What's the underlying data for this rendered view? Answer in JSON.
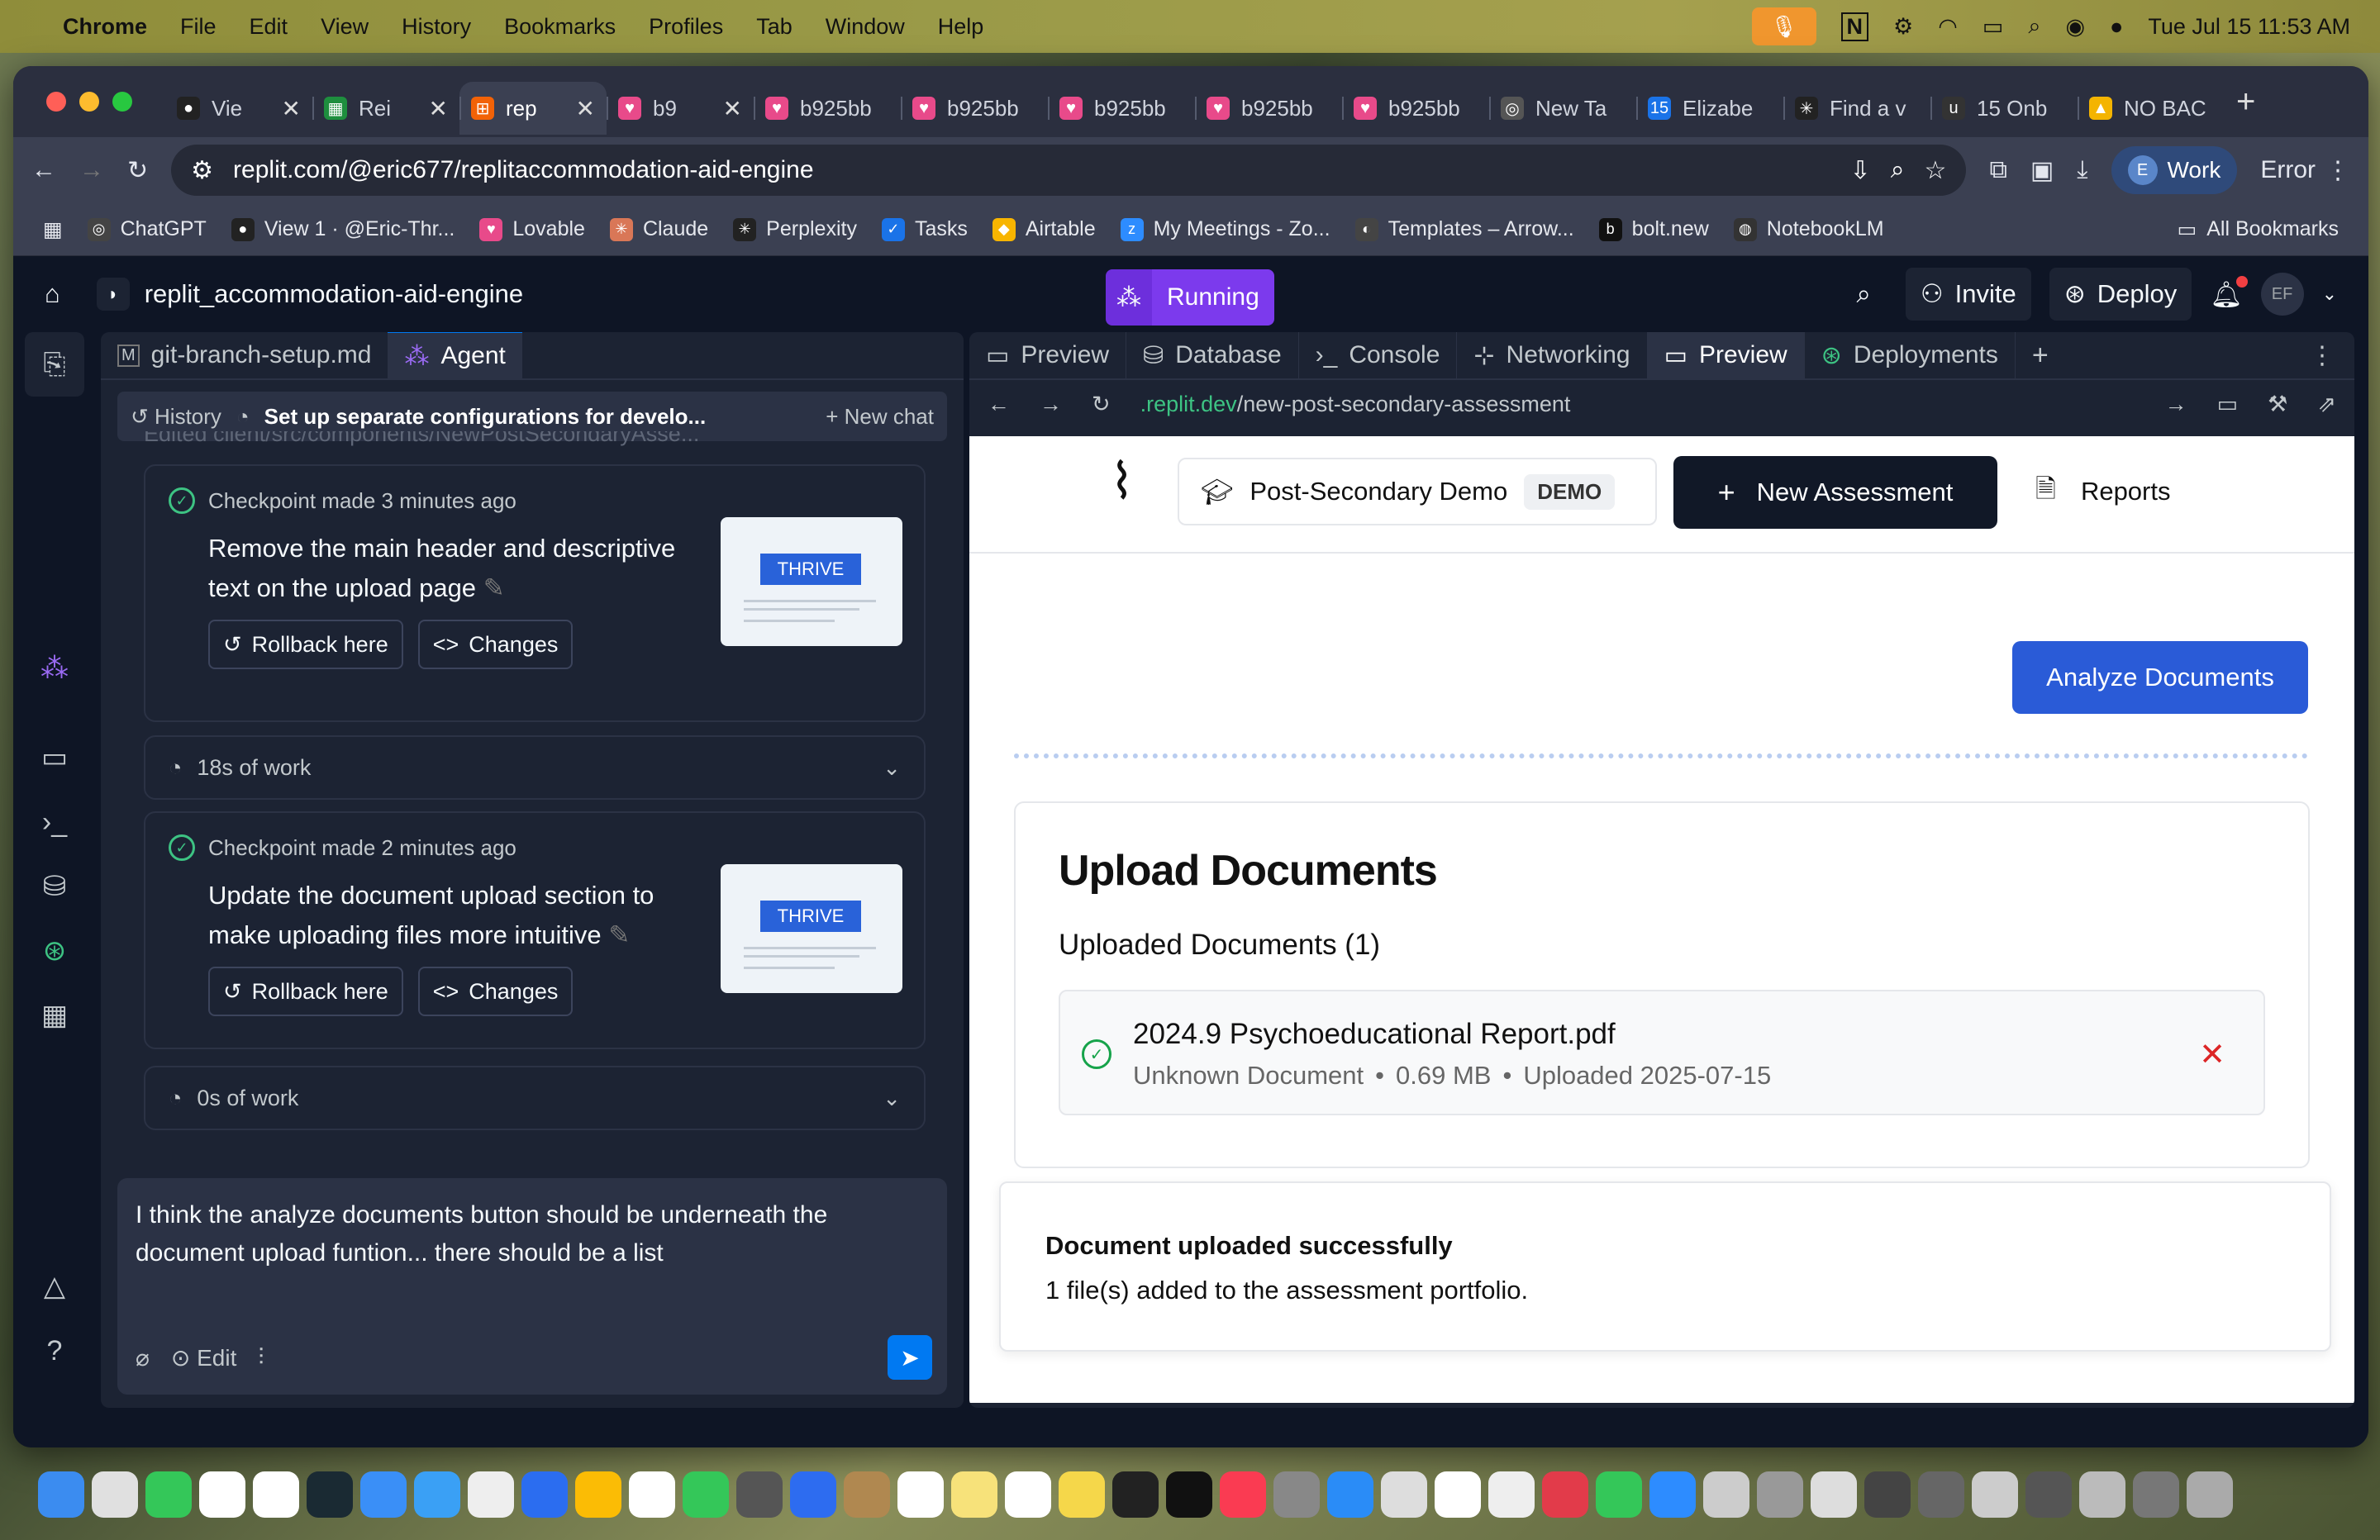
{
  "menubar": {
    "app": "Chrome",
    "items": [
      "File",
      "Edit",
      "View",
      "History",
      "Bookmarks",
      "Profiles",
      "Tab",
      "Window",
      "Help"
    ],
    "datetime": "Tue Jul 15  11:53 AM"
  },
  "tabs": [
    {
      "label": "Vie",
      "icon": "github-icon",
      "color": "#222"
    },
    {
      "label": "Rei",
      "icon": "sheets-icon",
      "color": "#1e8e3e"
    },
    {
      "label": "rep",
      "icon": "replit-icon",
      "color": "#f26207",
      "active": true
    },
    {
      "label": "b9",
      "icon": "lovable-icon",
      "color": "#e84a8a"
    },
    {
      "label": "b925bb",
      "icon": "lovable-icon",
      "color": "#e84a8a"
    },
    {
      "label": "b925bb",
      "icon": "lovable-icon",
      "color": "#e84a8a"
    },
    {
      "label": "b925bb",
      "icon": "lovable-icon",
      "color": "#e84a8a"
    },
    {
      "label": "b925bb",
      "icon": "lovable-icon",
      "color": "#e84a8a"
    },
    {
      "label": "b925bb",
      "icon": "lovable-icon",
      "color": "#e84a8a"
    },
    {
      "label": "New Ta",
      "icon": "chrome-icon",
      "color": "#555"
    },
    {
      "label": "Elizabe",
      "icon": "calendar-icon",
      "color": "#1a73e8"
    },
    {
      "label": "Find a v",
      "icon": "perplexity-icon",
      "color": "#222"
    },
    {
      "label": "15 Onb",
      "icon": "u-icon",
      "color": "#333"
    },
    {
      "label": "NO BAC",
      "icon": "drive-icon",
      "color": "#f4b400"
    }
  ],
  "address": {
    "url": "replit.com/@eric677/replitaccommodation-aid-engine",
    "profile_initial": "E",
    "profile": "Work",
    "error": "Error"
  },
  "bookmarks": [
    "ChatGPT",
    "View 1 · @Eric-Thr...",
    "Lovable",
    "Claude",
    "Perplexity",
    "Tasks",
    "Airtable",
    "My Meetings - Zo...",
    "Templates – Arrow...",
    "bolt.new",
    "NotebookLM"
  ],
  "all_bookmarks": "All Bookmarks",
  "replit": {
    "project": "replit_accommodation-aid-engine",
    "status": "Running",
    "invite": "Invite",
    "deploy": "Deploy",
    "avatar": "EF",
    "left_tabs": {
      "file": "git-branch-setup.md",
      "agent": "Agent"
    },
    "history": "History",
    "chat_title": "Set up separate configurations for develo...",
    "new_chat": "New chat",
    "partial_line": "Edited client/src/components/NewPostSecondaryAsse...",
    "checkpoints": [
      {
        "time": "Checkpoint made 3 minutes ago",
        "message": "Remove the main header and descriptive text on the upload page"
      },
      {
        "time": "Checkpoint made 2 minutes ago",
        "message": "Update the document upload section to make uploading files more intuitive"
      }
    ],
    "rollback": "Rollback here",
    "changes": "Changes",
    "thumb_brand": "THRIVE",
    "work": [
      "18s of work",
      "0s of work"
    ],
    "input_text": "I think the analyze documents button should be underneath the document upload funtion... there should be a list",
    "edit": "Edit",
    "right_tabs": [
      "Preview",
      "Database",
      "Console",
      "Networking",
      "Preview",
      "Deployments"
    ],
    "preview_url_host": ".replit.dev",
    "preview_url_path": "/new-post-secondary-assessment"
  },
  "webapp": {
    "demo_label": "Post-Secondary Demo",
    "demo_badge": "DEMO",
    "new_assessment": "New Assessment",
    "reports": "Reports",
    "analyze": "Analyze Documents",
    "upload_title": "Upload Documents",
    "uploaded_heading": "Uploaded Documents (1)",
    "file_name": "2024.9 Psychoeducational Report.pdf",
    "file_type": "Unknown Document",
    "file_size": "0.69 MB",
    "file_uploaded": "Uploaded 2025-07-15",
    "toast_title": "Document uploaded successfully",
    "toast_body": "1 file(s) added to the assessment portfolio."
  }
}
